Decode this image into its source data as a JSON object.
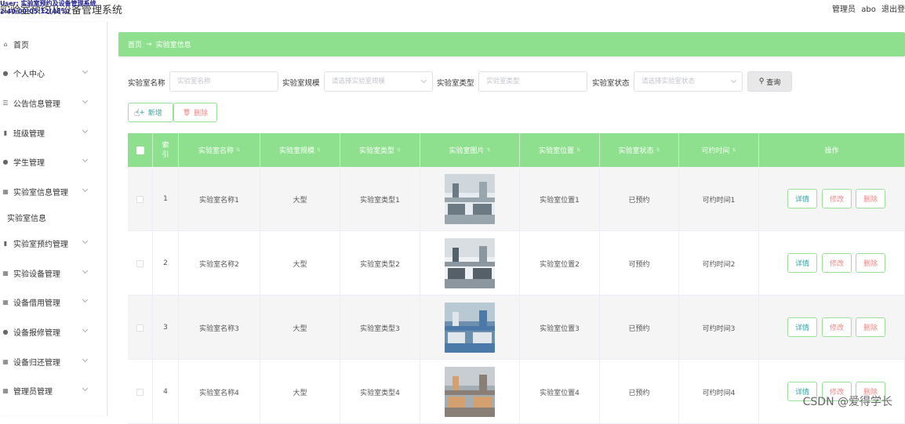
{
  "app": {
    "title": "实验室预约及设备管理系统",
    "overlay_line1": "User: 实验室预约及设备管理系统",
    "overlay_line2": "2:40/00:05:12(48%)",
    "admin_label": "管理员",
    "admin_name": "abo",
    "logout": "退出登"
  },
  "sidebar": {
    "items": [
      {
        "label": "首页",
        "icon": "home-icon"
      },
      {
        "label": "个人中心",
        "icon": "user-icon"
      },
      {
        "label": "公告信息管理",
        "icon": "list-icon"
      },
      {
        "label": "班级管理",
        "icon": "bar-chart-icon"
      },
      {
        "label": "学生管理",
        "icon": "user-icon"
      },
      {
        "label": "实验室信息管理",
        "icon": "grid-icon"
      },
      {
        "label": "实验室预约管理",
        "icon": "bar-chart-icon"
      },
      {
        "label": "实验设备管理",
        "icon": "grid-icon"
      },
      {
        "label": "设备借用管理",
        "icon": "grid-icon"
      },
      {
        "label": "设备报修管理",
        "icon": "user-icon"
      },
      {
        "label": "设备归还管理",
        "icon": "grid-icon"
      },
      {
        "label": "管理员管理",
        "icon": "grid-icon"
      }
    ],
    "sub_item": "实验室信息"
  },
  "breadcrumb": {
    "home": "首页",
    "current": "实验室信息"
  },
  "search": {
    "name_label": "实验室名称",
    "name_placeholder": "实验室名称",
    "scale_label": "实验室规模",
    "scale_placeholder": "请选择实验室规模",
    "type_label": "实验室类型",
    "type_placeholder": "实验室类型",
    "status_label": "实验室状态",
    "status_placeholder": "请选择实验室状态",
    "query_button": "查询"
  },
  "actions": {
    "add": "新增",
    "delete": "删除"
  },
  "table": {
    "headers": [
      "索引",
      "实验室名称",
      "实验室规模",
      "实验室类型",
      "实验室图片",
      "实验室位置",
      "实验室状态",
      "可约时间",
      "操作"
    ],
    "rows": [
      {
        "index": "1",
        "name": "实验室名称1",
        "scale": "大型",
        "type": "实验室类型1",
        "location": "实验室位置1",
        "status": "已预约",
        "time": "可约时间1"
      },
      {
        "index": "2",
        "name": "实验室名称2",
        "scale": "大型",
        "type": "实验室类型2",
        "location": "实验室位置2",
        "status": "可预约",
        "time": "可约时间2"
      },
      {
        "index": "3",
        "name": "实验室名称3",
        "scale": "大型",
        "type": "实验室类型3",
        "location": "实验室位置3",
        "status": "已预约",
        "time": "可约时间3"
      },
      {
        "index": "4",
        "name": "实验室名称4",
        "scale": "大型",
        "type": "实验室类型4",
        "location": "实验室位置4",
        "status": "已预约",
        "time": "可约时间4"
      }
    ],
    "row_actions": {
      "detail": "详情",
      "edit": "修改",
      "delete": "删除"
    }
  },
  "watermark": "CSDN @爱得学长",
  "colors": {
    "accent_green": "#8ee08e",
    "detail_text": "#3aa3a3",
    "danger_text": "#e88888"
  }
}
